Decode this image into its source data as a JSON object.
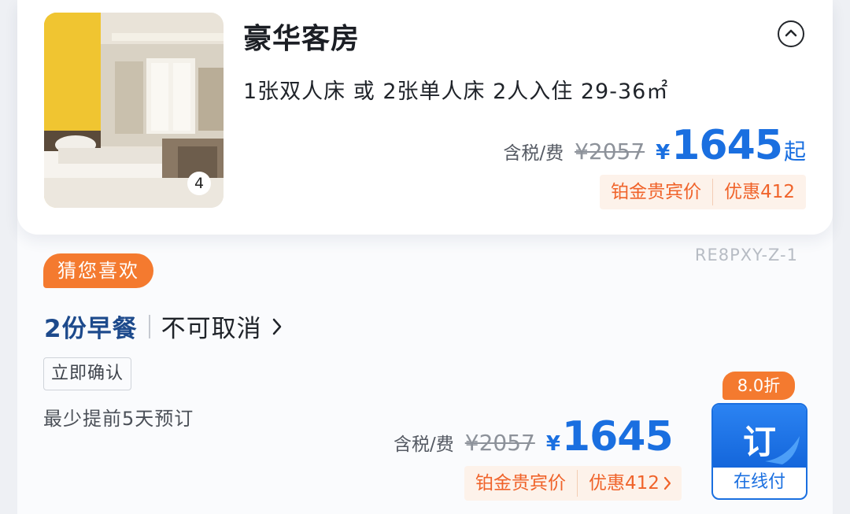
{
  "room": {
    "title": "豪华客房",
    "specs": "1张双人床 或 2张单人床  2人入住  29-36㎡",
    "photo_count": "4",
    "price": {
      "tax_label": "含税/费",
      "original": "¥2057",
      "currency": "¥",
      "amount": "1645",
      "suffix": "起"
    },
    "promo": {
      "member_label": "铂金贵宾价",
      "discount_label": "优惠412"
    }
  },
  "rate": {
    "code": "RE8PXY-Z-1",
    "recommend_tag": "猜您喜欢",
    "breakfast": "2份早餐",
    "cancel_policy": "不可取消",
    "confirm_tag": "立即确认",
    "advance_note": "最少提前5天预订",
    "price": {
      "tax_label": "含税/费",
      "original": "¥2057",
      "currency": "¥",
      "amount": "1645"
    },
    "promo": {
      "member_label": "铂金贵宾价",
      "discount_label": "优惠412"
    },
    "discount_badge": "8.0折",
    "book_button": {
      "label": "订",
      "sub_label": "在线付"
    }
  },
  "icons": {
    "collapse": "chevron-up-circle-icon",
    "cancel_detail": "chevron-right-icon",
    "promo_detail": "chevron-right-icon"
  },
  "colors": {
    "price_blue": "#1a6fe0",
    "promo_orange": "#f0632a",
    "tag_orange": "#f47a2f",
    "breakfast_navy": "#1d4a8c"
  }
}
